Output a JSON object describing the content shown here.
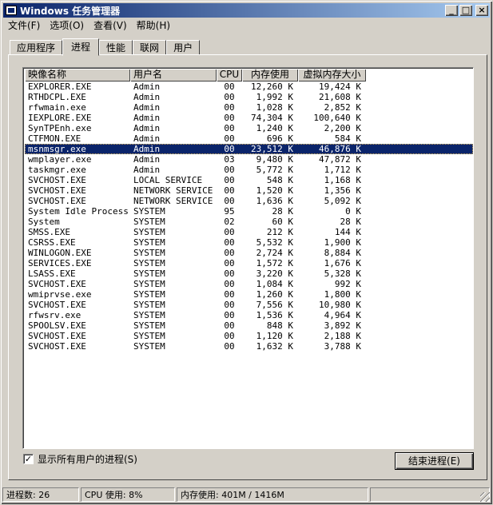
{
  "window": {
    "title": "Windows 任务管理器",
    "minimize_glyph": "_",
    "maximize_glyph": "□",
    "close_glyph": "×"
  },
  "menu": [
    "文件(F)",
    "选项(O)",
    "查看(V)",
    "帮助(H)"
  ],
  "tabs": [
    "应用程序",
    "进程",
    "性能",
    "联网",
    "用户"
  ],
  "active_tab": 1,
  "columns": [
    "映像名称",
    "用户名",
    "CPU",
    "内存使用",
    "虚拟内存大小"
  ],
  "processes": [
    [
      "EXPLORER.EXE",
      "Admin",
      "00",
      "12,260 K",
      "19,424 K"
    ],
    [
      "RTHDCPL.EXE",
      "Admin",
      "00",
      "1,992 K",
      "21,608 K"
    ],
    [
      "rfwmain.exe",
      "Admin",
      "00",
      "1,028 K",
      "2,852 K"
    ],
    [
      "IEXPLORE.EXE",
      "Admin",
      "00",
      "74,304 K",
      "100,640 K"
    ],
    [
      "SynTPEnh.exe",
      "Admin",
      "00",
      "1,240 K",
      "2,200 K"
    ],
    [
      "CTFMON.EXE",
      "Admin",
      "00",
      "696 K",
      "584 K"
    ],
    [
      "msnmsgr.exe",
      "Admin",
      "00",
      "23,512 K",
      "46,876 K"
    ],
    [
      "wmplayer.exe",
      "Admin",
      "03",
      "9,480 K",
      "47,872 K"
    ],
    [
      "taskmgr.exe",
      "Admin",
      "00",
      "5,772 K",
      "1,712 K"
    ],
    [
      "SVCHOST.EXE",
      "LOCAL SERVICE",
      "00",
      "548 K",
      "1,168 K"
    ],
    [
      "SVCHOST.EXE",
      "NETWORK SERVICE",
      "00",
      "1,520 K",
      "1,356 K"
    ],
    [
      "SVCHOST.EXE",
      "NETWORK SERVICE",
      "00",
      "1,636 K",
      "5,092 K"
    ],
    [
      "System Idle Process",
      "SYSTEM",
      "95",
      "28 K",
      "0 K"
    ],
    [
      "System",
      "SYSTEM",
      "02",
      "60 K",
      "28 K"
    ],
    [
      "SMSS.EXE",
      "SYSTEM",
      "00",
      "212 K",
      "144 K"
    ],
    [
      "CSRSS.EXE",
      "SYSTEM",
      "00",
      "5,532 K",
      "1,900 K"
    ],
    [
      "WINLOGON.EXE",
      "SYSTEM",
      "00",
      "2,724 K",
      "8,884 K"
    ],
    [
      "SERVICES.EXE",
      "SYSTEM",
      "00",
      "1,572 K",
      "1,676 K"
    ],
    [
      "LSASS.EXE",
      "SYSTEM",
      "00",
      "3,220 K",
      "5,328 K"
    ],
    [
      "SVCHOST.EXE",
      "SYSTEM",
      "00",
      "1,084 K",
      "992 K"
    ],
    [
      "wmiprvse.exe",
      "SYSTEM",
      "00",
      "1,260 K",
      "1,800 K"
    ],
    [
      "SVCHOST.EXE",
      "SYSTEM",
      "00",
      "7,556 K",
      "10,980 K"
    ],
    [
      "rfwsrv.exe",
      "SYSTEM",
      "00",
      "1,536 K",
      "4,964 K"
    ],
    [
      "SPOOLSV.EXE",
      "SYSTEM",
      "00",
      "848 K",
      "3,892 K"
    ],
    [
      "SVCHOST.EXE",
      "SYSTEM",
      "00",
      "1,120 K",
      "2,188 K"
    ],
    [
      "SVCHOST.EXE",
      "SYSTEM",
      "00",
      "1,632 K",
      "3,788 K"
    ]
  ],
  "selected_row": 6,
  "show_all_users": {
    "checked": true,
    "check_glyph": "✓",
    "label": "显示所有用户的进程(S)"
  },
  "end_process_label": "结束进程(E)",
  "status": {
    "processes": "进程数: 26",
    "cpu": "CPU 使用: 8%",
    "memory": "内存使用: 401M / 1416M"
  },
  "colors": {
    "face": "#d4d0c8",
    "selection": "#0a246a",
    "title_start": "#0a246a",
    "title_end": "#a6caf0"
  }
}
